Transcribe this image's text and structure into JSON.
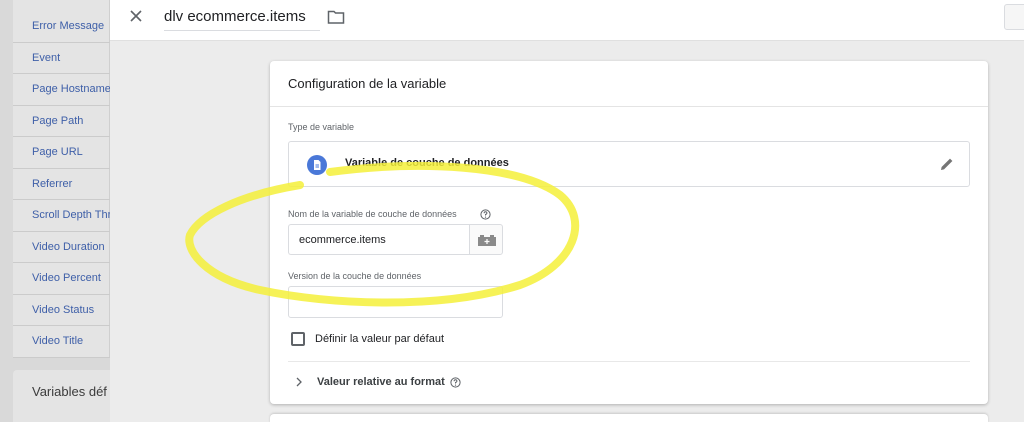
{
  "background_list": {
    "items": [
      "Error Message",
      "Event",
      "Page Hostname",
      "Page Path",
      "Page URL",
      "Referrer",
      "Scroll Depth Threshold",
      "Video Duration",
      "Video Percent",
      "Video Status",
      "Video Title"
    ],
    "section_title": "Variables déf"
  },
  "header": {
    "title": "dlv ecommerce.items",
    "close_icon": "close-icon",
    "folder_icon": "folder-icon"
  },
  "config": {
    "title": "Configuration de la variable",
    "variable_type_label": "Type de variable",
    "variable_type_name": "Variable de couche de données",
    "variable_type_icon": "document-icon",
    "dl_var_name_label": "Nom de la variable de couche de données",
    "dl_var_name_value": "ecommerce.items",
    "dl_version_label": "Version de la couche de données",
    "default_value_label": "Définir la valeur par défaut",
    "format_value_label": "Valeur relative au format"
  },
  "colors": {
    "accent": "#4a78d8",
    "highlight": "#f4f03a",
    "link": "#3e5fa8"
  }
}
